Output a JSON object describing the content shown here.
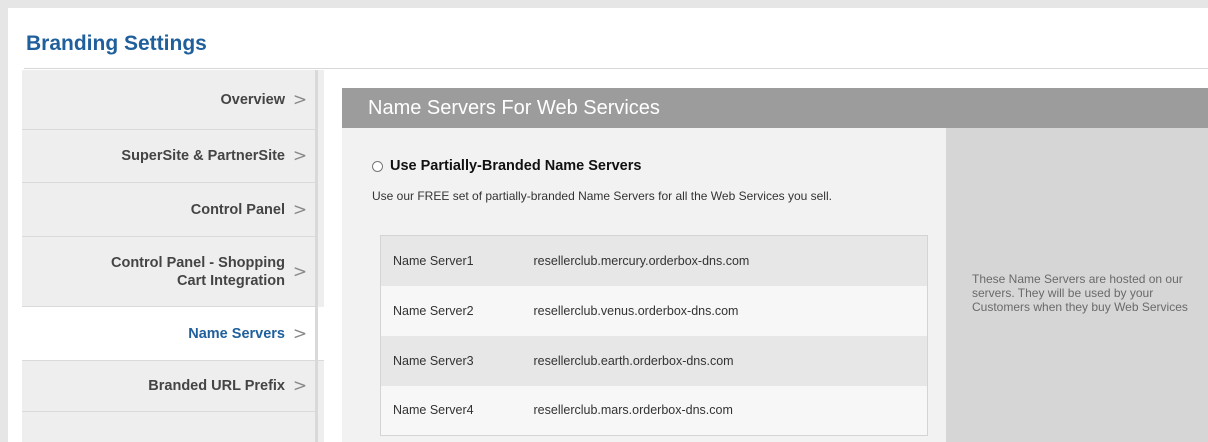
{
  "page": {
    "title": "Branding Settings"
  },
  "sidebar": {
    "items": [
      {
        "label": "Overview",
        "active": false
      },
      {
        "label": "SuperSite & PartnerSite",
        "active": false
      },
      {
        "label": "Control Panel",
        "active": false
      },
      {
        "label": "Control Panel - Shopping Cart Integration",
        "label_line1": "Control Panel - Shopping",
        "label_line2": "Cart Integration",
        "active": false
      },
      {
        "label": "Name Servers",
        "active": true
      },
      {
        "label": "Branded URL Prefix",
        "active": false
      }
    ],
    "chevron": ">"
  },
  "panel": {
    "header": "Name Servers For Web Services",
    "option": {
      "label": "Use Partially-Branded Name Servers",
      "selected": false,
      "description": "Use our FREE set of partially-branded Name Servers for all the Web Services you sell."
    },
    "name_servers": [
      {
        "name": "Name Server1",
        "host": "resellerclub.mercury.orderbox-dns.com"
      },
      {
        "name": "Name Server2",
        "host": "resellerclub.venus.orderbox-dns.com"
      },
      {
        "name": "Name Server3",
        "host": "resellerclub.earth.orderbox-dns.com"
      },
      {
        "name": "Name Server4",
        "host": "resellerclub.mars.orderbox-dns.com"
      }
    ],
    "aside_text": "These Name Servers are hosted on our servers. They will be used by your Customers when they buy Web Services"
  },
  "colors": {
    "title": "#1f5f9c",
    "active_nav": "#1f5f9c",
    "header_bg": "#9c9c9c",
    "aside_bg": "#d6d6d6"
  }
}
